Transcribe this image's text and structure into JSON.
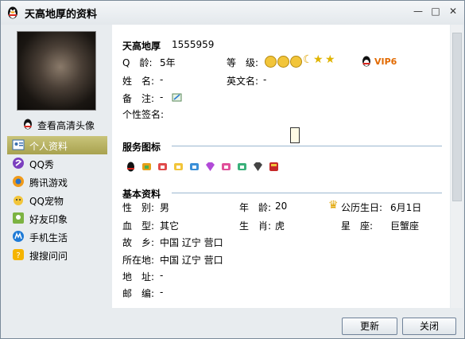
{
  "window": {
    "title": "天高地厚的资料",
    "min": "—",
    "max": "□",
    "close": "✕"
  },
  "left": {
    "view_hd_avatar": "查看高清头像",
    "nav": [
      {
        "label": "个人资料",
        "icon": "profile-card-icon"
      },
      {
        "label": "QQ秀",
        "icon": "qqshow-icon"
      },
      {
        "label": "腾讯游戏",
        "icon": "game-icon"
      },
      {
        "label": "QQ宠物",
        "icon": "pet-icon"
      },
      {
        "label": "好友印象",
        "icon": "impression-icon"
      },
      {
        "label": "手机生活",
        "icon": "mobile-life-icon"
      },
      {
        "label": "搜搜问问",
        "icon": "soso-ask-icon"
      }
    ]
  },
  "profile": {
    "nickname": "天高地厚",
    "qq_number": "1555959",
    "q_age_label": "Q　龄:",
    "q_age_value": "5年",
    "level_label": "等　级:",
    "vip_text": "VIP6",
    "name_label": "姓　名:",
    "name_value": "-",
    "english_name_label": "英文名:",
    "english_name_value": "-",
    "remark_label": "备　注:",
    "remark_value": "-",
    "signature_label": "个性签名:"
  },
  "service_icons": {
    "title": "服务图标"
  },
  "basic": {
    "title": "基本资料",
    "gender_label": "性　别:",
    "gender_value": "男",
    "age_label": "年　龄:",
    "age_value": "20",
    "birthday_label": "公历生日:",
    "birthday_value": "6月1日",
    "blood_label": "血　型:",
    "blood_value": "其它",
    "zodiac_label": "生　肖:",
    "zodiac_value": "虎",
    "star_label": "星　座:",
    "star_value": "巨蟹座",
    "hometown_label": "故　乡:",
    "hometown_value": "中国 辽宁 营口",
    "location_label": "所在地:",
    "location_value": "中国 辽宁 营口",
    "address_label": "地　址:",
    "address_value": "-",
    "postcode_label": "邮　编:",
    "postcode_value": "-"
  },
  "footer": {
    "refresh": "更新",
    "close": "关闭"
  }
}
